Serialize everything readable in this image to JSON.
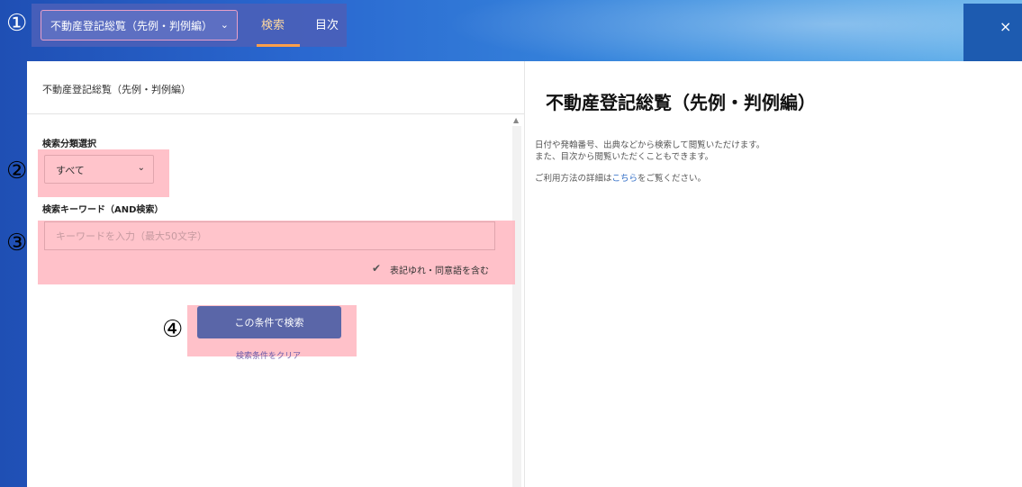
{
  "header": {
    "book_select": "不動産登記総覧（先例・判例編）",
    "tabs": [
      {
        "label": "検索"
      },
      {
        "label": "目次"
      }
    ],
    "close": "×"
  },
  "callouts": [
    "①",
    "②",
    "③",
    "④"
  ],
  "left_panel": {
    "title": "不動産登記総覧（先例・判例編）",
    "category_label": "検索分類選択",
    "category_value": "すべて",
    "keyword_label": "検索キーワード（AND検索）",
    "keyword_placeholder": "キーワードを入力（最大50文字）",
    "keyword_value": "",
    "synonym_checkbox": "表記ゆれ・同意語を含む",
    "synonym_checked": true,
    "search_button": "この条件で検索",
    "clear_link": "検索条件をクリア"
  },
  "right_panel": {
    "title": "不動産登記総覧（先例・判例編）",
    "desc_line1": "日付や発翰番号、出典などから検索して閲覧いただけます。",
    "desc_line2": "また、目次から閲覧いただくこともできます。",
    "usage_prefix": "ご利用方法の詳細は",
    "usage_link": "こちら",
    "usage_suffix": "をご覧ください。"
  },
  "colors": {
    "accent_tab": "#ff9f4a",
    "button": "#5a66a8",
    "highlight": "#ffb6c0",
    "link": "#2a69c4"
  }
}
